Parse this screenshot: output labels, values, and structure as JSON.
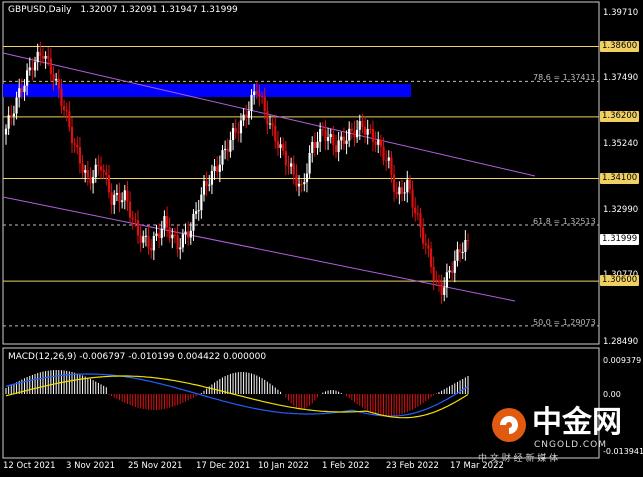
{
  "header": {
    "symbol_tf": "GBPUSD,Daily",
    "ohlc": "1.32007 1.32091 1.31947 1.31999"
  },
  "price_axis": [
    "1.39710",
    "1.37490",
    "1.35240",
    "1.32990",
    "1.30770",
    "1.28490"
  ],
  "price_tags": [
    {
      "text": "1.38600",
      "bg": "#f0d060",
      "fg": "#000000",
      "price": 1.386
    },
    {
      "text": "1.36200",
      "bg": "#f0d060",
      "fg": "#000000",
      "price": 1.362
    },
    {
      "text": "1.34100",
      "bg": "#f0d060",
      "fg": "#000000",
      "price": 1.341
    },
    {
      "text": "1.31999",
      "bg": "#ffffff",
      "fg": "#000000",
      "price": 1.31999
    },
    {
      "text": "1.30600",
      "bg": "#f0d060",
      "fg": "#000000",
      "price": 1.306
    }
  ],
  "fib_labels": [
    {
      "text": "78.6 = 1.37411",
      "price": 1.37411
    },
    {
      "text": "61.8 = 1.32513",
      "price": 1.32513
    },
    {
      "text": "50.0 = 1.29073",
      "price": 1.29073
    }
  ],
  "macd": {
    "label": "MACD(12,26,9) -0.006797 -0.010199 0.004422 0.000000",
    "axis": [
      "0.009379",
      "0.00",
      "-0.013941"
    ]
  },
  "time_axis": [
    "12 Oct 2021",
    "3 Nov 2021",
    "25 Nov 2021",
    "17 Dec 2021",
    "10 Jan 2022",
    "1 Feb 2022",
    "23 Feb 2022",
    "17 Mar 2022"
  ],
  "watermark": {
    "brand": "中金网",
    "domain": "CNGOLD.COM",
    "slogan": "中 文 财 经 新 媒 体"
  },
  "colors": {
    "bull": "#ffffff",
    "bear": "#e01010",
    "level_line": "#f0d060",
    "channel": "#b060e0",
    "zone": "#0000ff",
    "macd_main": "#2060ff",
    "macd_signal": "#f0e000"
  }
}
